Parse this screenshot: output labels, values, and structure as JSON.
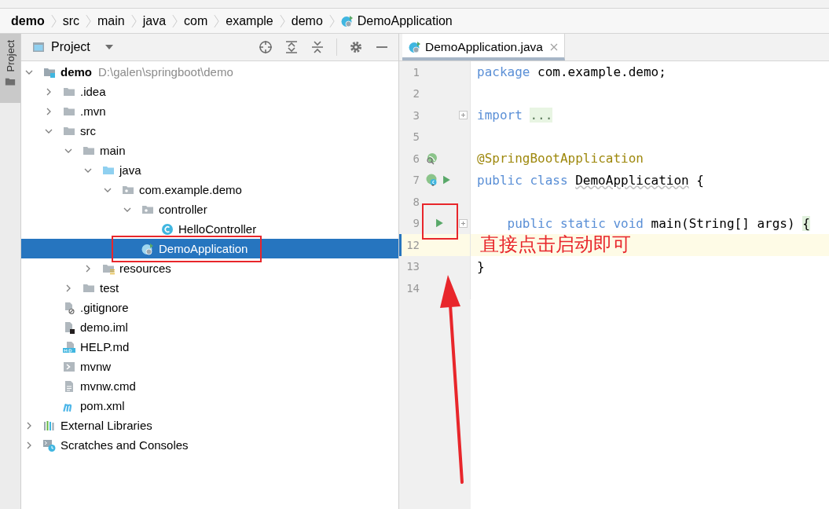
{
  "breadcrumbs": [
    {
      "label": "demo",
      "kind": "module"
    },
    {
      "label": "src",
      "kind": "folder"
    },
    {
      "label": "main",
      "kind": "folder"
    },
    {
      "label": "java",
      "kind": "folder"
    },
    {
      "label": "com",
      "kind": "folder"
    },
    {
      "label": "example",
      "kind": "folder"
    },
    {
      "label": "demo",
      "kind": "folder"
    },
    {
      "label": "DemoApplication",
      "kind": "spring-class"
    }
  ],
  "project_panel": {
    "side_tab": "Project",
    "title": "Project",
    "tree": [
      {
        "label": "demo",
        "hint": "D:\\galen\\springboot\\demo",
        "kind": "module",
        "expanded": true,
        "selected": false,
        "annotated": false,
        "children": [
          {
            "label": ".idea",
            "kind": "folder",
            "expanded": false,
            "selected": false,
            "annotated": false
          },
          {
            "label": ".mvn",
            "kind": "folder",
            "expanded": false,
            "selected": false,
            "annotated": false
          },
          {
            "label": "src",
            "kind": "folder",
            "expanded": true,
            "selected": false,
            "annotated": false,
            "children": [
              {
                "label": "main",
                "kind": "folder",
                "expanded": true,
                "selected": false,
                "annotated": false,
                "children": [
                  {
                    "label": "java",
                    "kind": "source-folder",
                    "expanded": true,
                    "selected": false,
                    "annotated": false,
                    "children": [
                      {
                        "label": "com.example.demo",
                        "kind": "package",
                        "expanded": true,
                        "selected": false,
                        "annotated": false,
                        "children": [
                          {
                            "label": "controller",
                            "kind": "package",
                            "expanded": true,
                            "selected": false,
                            "annotated": false,
                            "children": [
                              {
                                "label": "HelloController",
                                "kind": "class",
                                "selected": false,
                                "annotated": false
                              }
                            ]
                          },
                          {
                            "label": "DemoApplication",
                            "kind": "spring-class",
                            "selected": true,
                            "annotated": true
                          }
                        ]
                      }
                    ]
                  },
                  {
                    "label": "resources",
                    "kind": "resources-folder",
                    "expanded": false,
                    "selected": false,
                    "annotated": false
                  }
                ]
              },
              {
                "label": "test",
                "kind": "folder",
                "expanded": false,
                "selected": false,
                "annotated": false
              }
            ]
          },
          {
            "label": ".gitignore",
            "kind": "ignore-file",
            "selected": false,
            "annotated": false
          },
          {
            "label": "demo.iml",
            "kind": "module-file",
            "selected": false,
            "annotated": false
          },
          {
            "label": "HELP.md",
            "kind": "markdown",
            "selected": false,
            "annotated": false
          },
          {
            "label": "mvnw",
            "kind": "script",
            "selected": false,
            "annotated": false
          },
          {
            "label": "mvnw.cmd",
            "kind": "text-file",
            "selected": false,
            "annotated": false
          },
          {
            "label": "pom.xml",
            "kind": "maven",
            "selected": false,
            "annotated": false
          }
        ]
      },
      {
        "label": "External Libraries",
        "kind": "libraries",
        "expanded": false,
        "selected": false,
        "annotated": false
      },
      {
        "label": "Scratches and Consoles",
        "kind": "scratches",
        "expanded": false,
        "selected": false,
        "annotated": false
      }
    ]
  },
  "editor": {
    "tabs": [
      {
        "label": "DemoApplication.java",
        "selected": true
      }
    ],
    "lines": [
      {
        "number": "1",
        "fold": false,
        "annotated": false,
        "current": false,
        "tokens": [
          {
            "kind": "keyword",
            "text": "package"
          },
          {
            "kind": "plain",
            "text": "com.example.demo;"
          }
        ]
      },
      {
        "number": "2",
        "fold": false,
        "annotated": false,
        "current": false
      },
      {
        "number": "3",
        "fold": true,
        "annotated": false,
        "current": false,
        "tokens": [
          {
            "kind": "keyword",
            "text": "import"
          },
          {
            "kind": "folded",
            "text": "..."
          }
        ]
      },
      {
        "number": "5",
        "fold": false,
        "annotated": false,
        "current": false
      },
      {
        "number": "6",
        "fold": false,
        "annotated": false,
        "current": false,
        "gutter": [
          {
            "kind": "bean"
          }
        ],
        "tokens": [
          {
            "kind": "annotation",
            "text": "@SpringBootApplication"
          }
        ]
      },
      {
        "number": "7",
        "fold": false,
        "annotated": false,
        "current": false,
        "gutter": [
          {
            "kind": "spring-class"
          },
          {
            "kind": "run"
          }
        ],
        "tokens": [
          {
            "kind": "keyword",
            "text": "public class"
          },
          {
            "kind": "warning",
            "text": "DemoApplication"
          },
          {
            "kind": "plain",
            "text": "{"
          }
        ]
      },
      {
        "number": "8",
        "fold": false,
        "annotated": false,
        "current": false
      },
      {
        "number": "9",
        "fold": true,
        "annotated": true,
        "current": false,
        "gutter": [
          {
            "kind": "run"
          }
        ],
        "tokens": [
          {
            "kind": "keyword",
            "text": "    public static void"
          },
          {
            "kind": "plain",
            "text": "main(String[] args)"
          },
          {
            "kind": "brace-match",
            "text": "{"
          }
        ]
      },
      {
        "number": "12",
        "fold": false,
        "annotated": false,
        "current": true,
        "callout": "直接点击启动即可"
      },
      {
        "number": "13",
        "fold": false,
        "annotated": false,
        "current": false,
        "tokens": [
          {
            "kind": "plain",
            "text": "}"
          }
        ]
      },
      {
        "number": "14",
        "fold": false,
        "annotated": false,
        "current": false
      }
    ]
  }
}
